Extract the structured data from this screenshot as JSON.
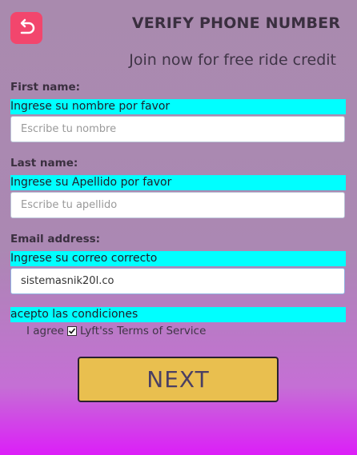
{
  "header": {
    "title": "VERIFY PHONE NUMBER",
    "subtitle": "Join now for free ride credit"
  },
  "form": {
    "first_name": {
      "label": "First name:",
      "hint": "Ingrese su nombre por favor",
      "value": "",
      "placeholder": "Escribe tu nombre"
    },
    "last_name": {
      "label": "Last name:",
      "hint": "Ingrese su Apellido por favor",
      "value": "",
      "placeholder": "Escribe tu apellido"
    },
    "email": {
      "label": "Email address:",
      "hint": "Ingrese su correo correcto",
      "value": "sistemasnik20l.co",
      "placeholder": ""
    },
    "terms": {
      "hint": "acepto las condiciones",
      "prefix": "I agree",
      "suffix": "Lyft'ss Terms of Service",
      "checked": true
    }
  },
  "next_label": "NEXT",
  "colors": {
    "accent": "#f2466d",
    "hint_bg": "#00ffff",
    "button_bg": "#e9bf4f"
  },
  "icons": {
    "back": "back-arrow-icon",
    "check": "check-icon"
  }
}
